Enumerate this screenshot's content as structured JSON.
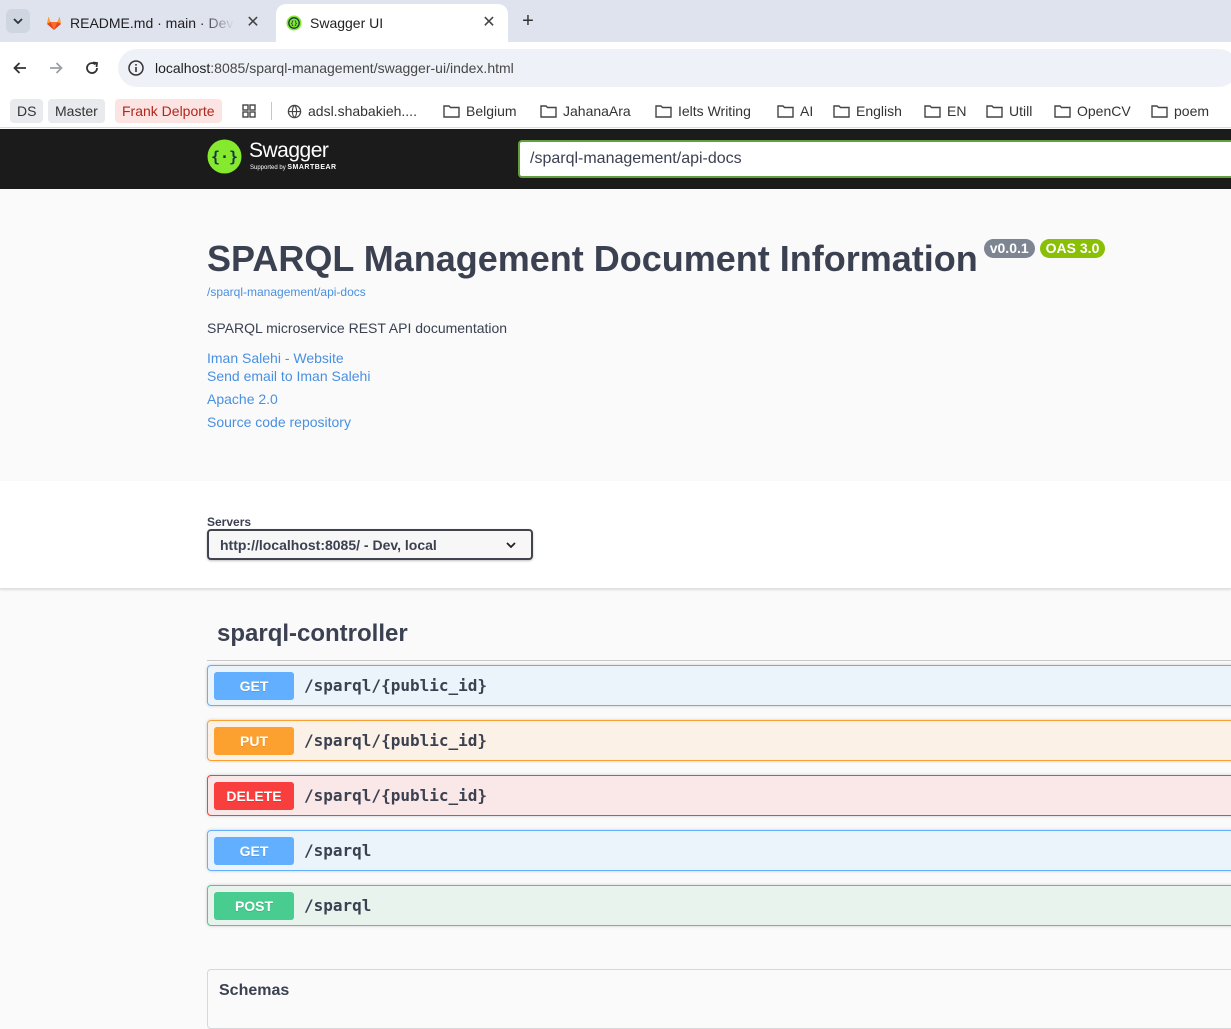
{
  "browser": {
    "tabs": [
      {
        "title": "README.md · main · Dev",
        "active": false,
        "icon": "gitlab-icon"
      },
      {
        "title": "Swagger UI",
        "active": true,
        "icon": "swagger-icon"
      }
    ],
    "address": {
      "host": "localhost",
      "path": ":8085/sparql-management/swagger-ui/index.html"
    },
    "bookmarks": [
      {
        "label": "DS",
        "icon": null
      },
      {
        "label": "Master",
        "icon": null
      },
      {
        "label": "Frank Delporte",
        "icon": null
      },
      {
        "label": "adsl.shabakieh....",
        "icon": "globe-icon"
      },
      {
        "label": "Belgium",
        "icon": "folder-icon"
      },
      {
        "label": "JahanaAra",
        "icon": "folder-icon"
      },
      {
        "label": "Ielts Writing",
        "icon": "folder-icon"
      },
      {
        "label": "AI",
        "icon": "folder-icon"
      },
      {
        "label": "English",
        "icon": "folder-icon"
      },
      {
        "label": "EN",
        "icon": "folder-icon"
      },
      {
        "label": "Utill",
        "icon": "folder-icon"
      },
      {
        "label": "OpenCV",
        "icon": "folder-icon"
      },
      {
        "label": "poem",
        "icon": "folder-icon"
      }
    ]
  },
  "swagger": {
    "brand": "Swagger",
    "tagline_prefix": "Supported by",
    "tagline_brand": "SMARTBEAR",
    "spec_url": "/sparql-management/api-docs"
  },
  "info": {
    "title": "SPARQL Management Document Information",
    "version": "v0.0.1",
    "oas": "OAS 3.0",
    "spec_link": "/sparql-management/api-docs",
    "description": "SPARQL microservice REST API documentation",
    "links": [
      "Iman Salehi - Website",
      "Send email to Iman Salehi",
      "Apache 2.0",
      "Source code repository"
    ]
  },
  "servers": {
    "label": "Servers",
    "selected": "http://localhost:8085/ - Dev, local"
  },
  "controller": {
    "name": "sparql-controller",
    "operations": [
      {
        "method": "GET",
        "path": "/sparql/{public_id}"
      },
      {
        "method": "PUT",
        "path": "/sparql/{public_id}"
      },
      {
        "method": "DELETE",
        "path": "/sparql/{public_id}"
      },
      {
        "method": "GET",
        "path": "/sparql"
      },
      {
        "method": "POST",
        "path": "/sparql"
      }
    ]
  },
  "schemas": {
    "title": "Schemas"
  },
  "colors": {
    "get": "#61affe",
    "put": "#fca130",
    "delete": "#f93e3e",
    "post": "#49cc90",
    "link": "#4990e2",
    "topbar": "#1b1b1b",
    "swagger_green": "#85ea2d"
  }
}
